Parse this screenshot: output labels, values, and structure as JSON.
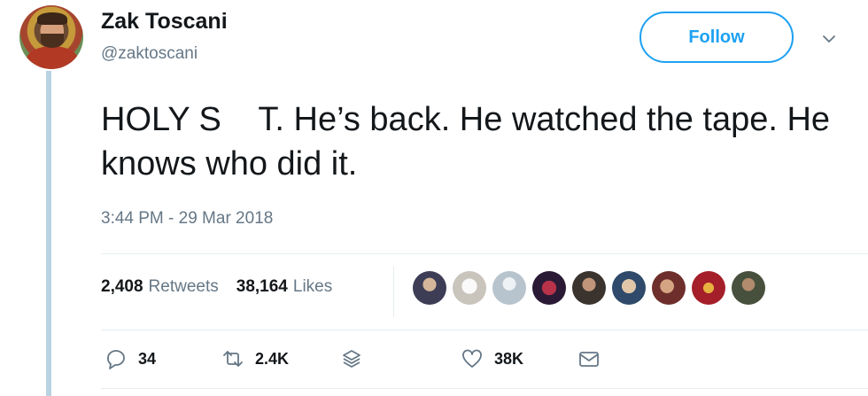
{
  "author": {
    "name": "Zak Toscani",
    "handle": "@zaktoscani"
  },
  "follow_label": "Follow",
  "tweet": {
    "text": "HOLY S    T. He’s back. He watched the tape. He knows who did it.",
    "timestamp": "3:44 PM - 29 Mar 2018"
  },
  "stats": {
    "retweets": "2,408",
    "retweets_label": "Retweets",
    "likes": "38,164",
    "likes_label": "Likes"
  },
  "actions": {
    "replies": "34",
    "retweets": "2.4K",
    "likes": "38K"
  },
  "colors": {
    "accent": "#1da1f2",
    "secondary_text": "#657786",
    "thread_line": "#b9d3e2"
  },
  "icons": [
    "chevron-down-icon",
    "reply-icon",
    "retweet-icon",
    "stack-icon",
    "heart-icon",
    "message-icon"
  ]
}
